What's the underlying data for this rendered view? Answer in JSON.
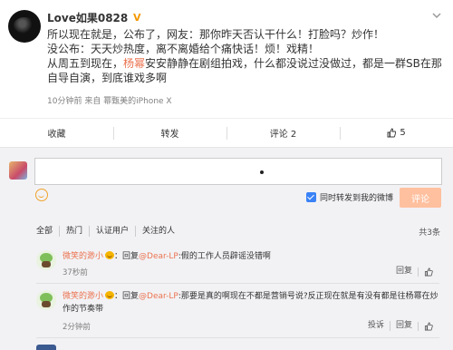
{
  "post": {
    "username": "Love如果0828",
    "vip_badge": "V",
    "lines": [
      "所以现在就是，公布了，网友：那你昨天否认干什么！打脸吗？炒作！",
      "没公布：天天炒热度，离不离婚给个痛快话！烦！戏精！"
    ],
    "line3_before": "从周五到现在，",
    "line3_highlight": "杨幂",
    "line3_after": "安安静静在剧组拍戏，什么都没说过没做过，都是一群SB在那自导自演，到底谁戏多啊",
    "meta": "10分钟前 来自 幂甄美的iPhone X",
    "actions": {
      "favorite": "收藏",
      "repost": "转发",
      "comment": "评论 2",
      "like_count": "5"
    }
  },
  "composer": {
    "placeholder": "",
    "repost_option": "同时转发到我的微博",
    "submit_label": "评论"
  },
  "tabs": {
    "items": [
      "全部",
      "热门",
      "认证用户",
      "关注的人"
    ],
    "total": "共3条"
  },
  "comments": [
    {
      "name": "微笑的渺小",
      "reply_prefix": "：回复",
      "reply_target": "@Dear-LP",
      "text": ":假的工作人员辟谣没错啊",
      "time": "37秒前",
      "ops": [
        "回复"
      ]
    },
    {
      "name": "微笑的渺小",
      "reply_prefix": "：回复",
      "reply_target": "@Dear-LP",
      "text": ":那要是真的啊现在不都是营销号说?反正现在就是有没有都是往杨幂在炒作的节奏带",
      "time": "2分钟前",
      "ops": [
        "投诉",
        "回复"
      ]
    }
  ],
  "colors": {
    "accent": "#eb7350",
    "submit_disabled": "#ffc09f",
    "checkbox": "#3a82f6"
  }
}
